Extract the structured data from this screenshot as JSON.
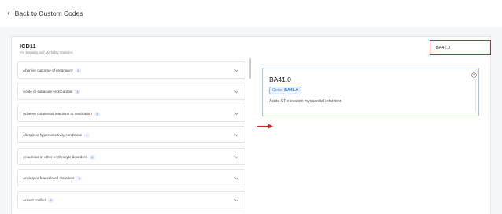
{
  "topbar": {
    "back_label": "Back to Custom Codes",
    "back_icon": "chevron-left-icon"
  },
  "panel": {
    "title": "ICD11",
    "subtitle": "For Mortality and Morbidity Statistics",
    "search": {
      "value": "BA41.0",
      "placeholder": ""
    }
  },
  "list": {
    "items": [
      {
        "label": "Abortive outcome of pregnancy",
        "count": "1"
      },
      {
        "label": "Acute or subacute endocarditis",
        "count": "1"
      },
      {
        "label": "Adverse cutaneous reactions to medication",
        "count": "1"
      },
      {
        "label": "Allergic or hypersensitivity conditions",
        "count": "1"
      },
      {
        "label": "Anaemias or other erythrocyte disorders",
        "count": "4"
      },
      {
        "label": "Anxiety or fear-related disorders",
        "count": "1"
      },
      {
        "label": "Armed conflict",
        "count": "9"
      }
    ]
  },
  "detail": {
    "title": "BA41.0",
    "code_prefix": "Code:",
    "code_value": "BA41.0",
    "description": "Acute ST elevation myocardial infarction"
  },
  "colors": {
    "highlight_border": "#e02020",
    "accent": "#3a6fd8",
    "card_border": "#9fc6e8"
  }
}
